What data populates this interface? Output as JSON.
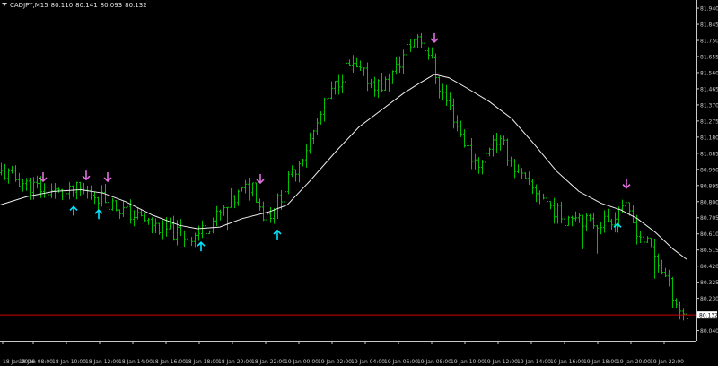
{
  "header": {
    "symbol": "CADJPY,M15",
    "open": "80.110",
    "high": "80.141",
    "low": "80.093",
    "close": "80.132"
  },
  "colors": {
    "background": "#000000",
    "bars": "#00c000",
    "ma_line": "#f0f0f0",
    "sell_arrow": "#e070e0",
    "buy_arrow": "#00e5ff",
    "price_line": "#d40000",
    "axis": "#c8c8c8",
    "price_label_bg": "#ffffff"
  },
  "chart_data": {
    "type": "ohlc",
    "xlabel": "",
    "ylabel": "",
    "ylim": [
      79.96,
      81.93
    ],
    "current_price": "80.132",
    "current_price_value": 80.132,
    "y_ticks": [
      "81.940",
      "81.845",
      "81.750",
      "81.655",
      "81.560",
      "81.465",
      "81.370",
      "81.275",
      "81.180",
      "81.085",
      "80.990",
      "80.895",
      "80.800",
      "80.705",
      "80.610",
      "80.515",
      "80.420",
      "80.325",
      "80.230",
      "80.040"
    ],
    "x_ticks": [
      "18 Jan 2016",
      "18 Jan 08:00",
      "18 Jan 10:00",
      "18 Jan 12:00",
      "18 Jan 14:00",
      "18 Jan 16:00",
      "18 Jan 18:00",
      "18 Jan 20:00",
      "18 Jan 22:00",
      "19 Jan 00:00",
      "19 Jan 02:00",
      "19 Jan 04:00",
      "19 Jan 06:00",
      "19 Jan 08:00",
      "19 Jan 10:00",
      "19 Jan 12:00",
      "19 Jan 14:00",
      "19 Jan 16:00",
      "19 Jan 18:00",
      "19 Jan 20:00",
      "19 Jan 22:00"
    ],
    "price_path": [
      [
        0,
        80.97
      ],
      [
        14,
        80.94
      ],
      [
        28,
        80.9
      ],
      [
        42,
        80.88
      ],
      [
        58,
        80.86
      ],
      [
        72,
        80.84
      ],
      [
        85,
        80.87
      ],
      [
        100,
        80.85
      ],
      [
        114,
        80.82
      ],
      [
        128,
        80.77
      ],
      [
        142,
        80.73
      ],
      [
        160,
        80.69
      ],
      [
        178,
        80.64
      ],
      [
        192,
        80.62
      ],
      [
        208,
        80.59
      ],
      [
        222,
        80.62
      ],
      [
        236,
        80.69
      ],
      [
        252,
        80.76
      ],
      [
        266,
        80.85
      ],
      [
        280,
        80.9
      ],
      [
        292,
        80.72
      ],
      [
        302,
        80.74
      ],
      [
        316,
        80.88
      ],
      [
        330,
        81.02
      ],
      [
        346,
        81.18
      ],
      [
        360,
        81.36
      ],
      [
        374,
        81.5
      ],
      [
        386,
        81.6
      ],
      [
        400,
        81.56
      ],
      [
        414,
        81.5
      ],
      [
        426,
        81.48
      ],
      [
        440,
        81.58
      ],
      [
        452,
        81.7
      ],
      [
        464,
        81.78
      ],
      [
        476,
        81.68
      ],
      [
        488,
        81.48
      ],
      [
        500,
        81.35
      ],
      [
        512,
        81.2
      ],
      [
        524,
        81.06
      ],
      [
        536,
        81.02
      ],
      [
        548,
        81.18
      ],
      [
        560,
        81.12
      ],
      [
        574,
        80.98
      ],
      [
        588,
        80.88
      ],
      [
        600,
        80.85
      ],
      [
        614,
        80.76
      ],
      [
        628,
        80.7
      ],
      [
        640,
        80.74
      ],
      [
        654,
        80.67
      ],
      [
        668,
        80.68
      ],
      [
        680,
        80.7
      ],
      [
        692,
        80.79
      ],
      [
        700,
        80.71
      ],
      [
        712,
        80.6
      ],
      [
        724,
        80.52
      ],
      [
        736,
        80.4
      ],
      [
        748,
        80.26
      ],
      [
        758,
        80.14
      ],
      [
        766,
        80.12
      ]
    ],
    "moving_average": [
      [
        0,
        80.78
      ],
      [
        30,
        80.83
      ],
      [
        60,
        80.86
      ],
      [
        90,
        80.87
      ],
      [
        115,
        80.85
      ],
      [
        140,
        80.8
      ],
      [
        170,
        80.72
      ],
      [
        200,
        80.66
      ],
      [
        220,
        80.64
      ],
      [
        245,
        80.65
      ],
      [
        270,
        80.7
      ],
      [
        300,
        80.74
      ],
      [
        320,
        80.78
      ],
      [
        345,
        80.92
      ],
      [
        375,
        81.1
      ],
      [
        400,
        81.24
      ],
      [
        425,
        81.34
      ],
      [
        450,
        81.44
      ],
      [
        468,
        81.5
      ],
      [
        484,
        81.55
      ],
      [
        500,
        81.53
      ],
      [
        520,
        81.47
      ],
      [
        545,
        81.39
      ],
      [
        570,
        81.29
      ],
      [
        595,
        81.14
      ],
      [
        620,
        80.98
      ],
      [
        645,
        80.86
      ],
      [
        670,
        80.79
      ],
      [
        692,
        80.75
      ],
      [
        710,
        80.7
      ],
      [
        730,
        80.62
      ],
      [
        750,
        80.52
      ],
      [
        765,
        80.46
      ]
    ],
    "sell_signals": [
      {
        "x": 48,
        "price": 80.92
      },
      {
        "x": 96,
        "price": 80.93
      },
      {
        "x": 120,
        "price": 80.92
      },
      {
        "x": 290,
        "price": 80.91
      },
      {
        "x": 484,
        "price": 81.74
      },
      {
        "x": 698,
        "price": 80.88
      }
    ],
    "buy_signals": [
      {
        "x": 82,
        "price": 80.77
      },
      {
        "x": 110,
        "price": 80.75
      },
      {
        "x": 224,
        "price": 80.56
      },
      {
        "x": 309,
        "price": 80.63
      },
      {
        "x": 688,
        "price": 80.67
      }
    ]
  }
}
